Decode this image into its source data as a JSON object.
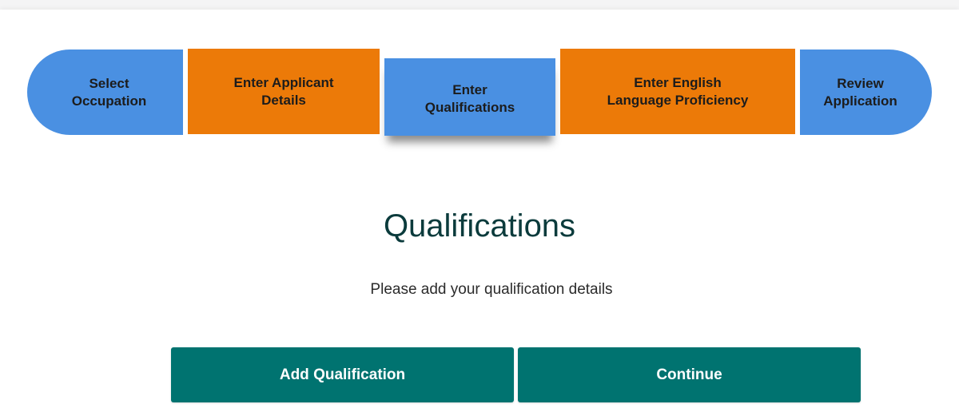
{
  "stepper": {
    "steps": [
      {
        "label": "Select\nOccupation",
        "color": "#4a90e2",
        "state": "done"
      },
      {
        "label": "Enter Applicant\nDetails",
        "color": "#ec7a08",
        "state": "done"
      },
      {
        "label": "Enter\nQualifications",
        "color": "#4a90e2",
        "state": "current"
      },
      {
        "label": "Enter English\nLanguage Proficiency",
        "color": "#ec7a08",
        "state": "todo"
      },
      {
        "label": "Review\nApplication",
        "color": "#4a90e2",
        "state": "todo"
      }
    ]
  },
  "main": {
    "title": "Qualifications",
    "subtitle": "Please add your qualification details",
    "add_button_label": "Add Qualification",
    "continue_button_label": "Continue"
  },
  "colors": {
    "primary_button": "#007370",
    "title": "#0b3b3c",
    "step_blue": "#4a90e2",
    "step_orange": "#ec7a08"
  }
}
